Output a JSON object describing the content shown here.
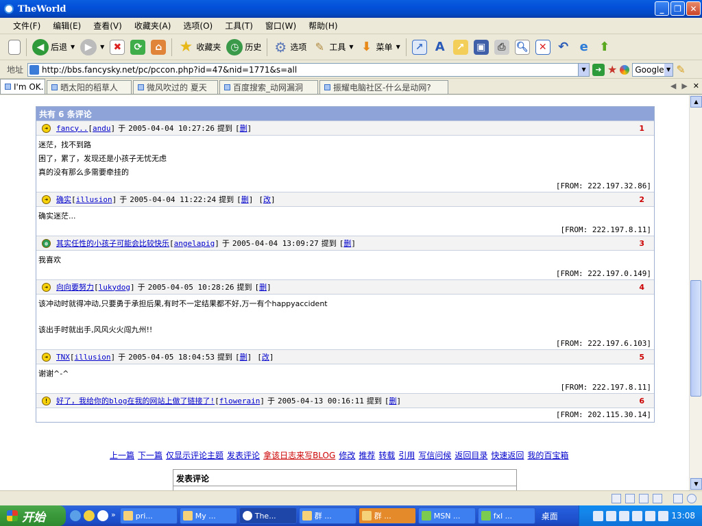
{
  "window": {
    "title": "TheWorld"
  },
  "menu": [
    "文件(F)",
    "编辑(E)",
    "查看(V)",
    "收藏夹(A)",
    "选项(O)",
    "工具(T)",
    "窗口(W)",
    "帮助(H)"
  ],
  "toolbar": {
    "back": "后退",
    "favorites": "收藏夹",
    "history": "历史",
    "options": "选项",
    "tools": "工具",
    "menu": "菜单"
  },
  "address": {
    "label": "地址",
    "url": "http://bbs.fancysky.net/pc/pccon.php?id=47&nid=1771&s=all",
    "search_engine": "Google"
  },
  "tabs": [
    "I'm OK.",
    "晒太阳的稻草人",
    "微风吹过的 夏天",
    "百度搜索_动网漏洞",
    "振耀电脑社区-什么是动网?"
  ],
  "comments_header": "共有 6 条评论",
  "comments": [
    {
      "title": "fancy..",
      "user": "andu",
      "time": "2005-04-04 10:27:26",
      "said": "提到",
      "actions": [
        "删"
      ],
      "num": "1",
      "body": [
        "迷茫，找不到路",
        "困了，累了，发现还是小孩子无忧无虑",
        "真的没有那么多需要牵挂的"
      ],
      "from": "[FROM: 222.197.32.86]"
    },
    {
      "title": "确实",
      "user": "illusion",
      "time": "2005-04-04 11:22:24",
      "said": "提到",
      "actions": [
        "删",
        "改"
      ],
      "num": "2",
      "body": [
        "确实迷茫..."
      ],
      "from": "[FROM: 222.197.8.11]"
    },
    {
      "title": "其实任性的小孩子可能会比较快乐",
      "user": "angelapig",
      "time": "2005-04-04 13:09:27",
      "said": "提到",
      "actions": [
        "删"
      ],
      "num": "3",
      "body": [
        "我喜欢"
      ],
      "from": "[FROM: 222.197.0.149]"
    },
    {
      "title": "向向要努力",
      "user": "lukydog",
      "time": "2005-04-05 10:28:26",
      "said": "提到",
      "actions": [
        "删"
      ],
      "num": "4",
      "body": [
        "该冲动时就得冲动,只要勇于承担后果,有时不一定结果都不好,万一有个happyaccident",
        "",
        "该出手时就出手,风风火火闯九州!!"
      ],
      "from": "[FROM: 222.197.6.103]"
    },
    {
      "title": "TNX",
      "user": "illusion",
      "time": "2005-04-05 18:04:53",
      "said": "提到",
      "actions": [
        "删",
        "改"
      ],
      "num": "5",
      "body": [
        "谢谢^-^"
      ],
      "from": "[FROM: 222.197.8.11]"
    },
    {
      "title": "好了，我给你的blog在我的网站上做了链接了!",
      "user": "flowerain",
      "time": "2005-04-13 00:16:11",
      "said": "提到",
      "actions": [
        "删"
      ],
      "num": "6",
      "body": [],
      "from": "[FROM: 202.115.30.14]"
    }
  ],
  "bottom_links": [
    "上一篇",
    "下一篇",
    "仅显示评论主题",
    "发表评论",
    "拿该日志来写BLOG",
    "修改",
    "推荐",
    "转载",
    "引用",
    "写信问候",
    "返回目录",
    "快速返回",
    "我的百宝箱"
  ],
  "post_box_title": "发表评论",
  "taskbar": {
    "start": "开始",
    "tasks": [
      "pri...",
      "My ...",
      "The...",
      "群 ...",
      "群 ...",
      "MSN ...",
      "fxl ..."
    ],
    "desktop": "桌面",
    "clock": "13:08"
  }
}
